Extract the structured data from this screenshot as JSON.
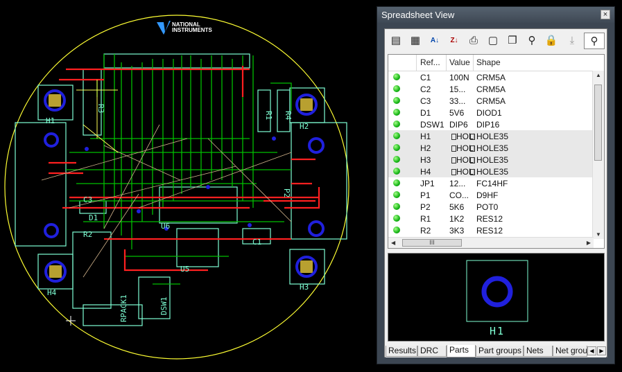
{
  "board": {
    "logo_line1": "NATIONAL",
    "logo_line2": "INSTRUMENTS",
    "labels": [
      "H1",
      "H2",
      "H3",
      "H4",
      "R3",
      "R1",
      "R4",
      "C3",
      "D1",
      "R2",
      "U5",
      "C1",
      "U6",
      "P2",
      "RPACK1",
      "DSW1"
    ],
    "colors": {
      "outline": "#ffff33",
      "silk": "#7fffd4",
      "top": "#ff2020",
      "bottom": "#00c000",
      "pad": "#0000cc",
      "ratsnest": "#d2b48c"
    }
  },
  "panel": {
    "title": "Spreadsheet View",
    "close": "×",
    "toolbar": [
      "page-icon",
      "spreadsheet-icon",
      "sort-az-icon",
      "sort-za-icon",
      "print-icon",
      "select-icon",
      "copy-icon",
      "find-icon",
      "lock-icon",
      "import-icon",
      "zoom-icon"
    ],
    "columns": [
      "Ref...",
      "Value",
      "Shape"
    ],
    "rows": [
      {
        "ref": "C1",
        "value": "100N",
        "shape": "CRM5A",
        "sel": false,
        "hole": false
      },
      {
        "ref": "C2",
        "value": "15...",
        "shape": "CRM5A",
        "sel": false,
        "hole": false
      },
      {
        "ref": "C3",
        "value": "33...",
        "shape": "CRM5A",
        "sel": false,
        "hole": false
      },
      {
        "ref": "D1",
        "value": "5V6",
        "shape": "DIOD1",
        "sel": false,
        "hole": false
      },
      {
        "ref": "DSW1",
        "value": "DIP6",
        "shape": "DIP16",
        "sel": false,
        "hole": false
      },
      {
        "ref": "H1",
        "value": "HOLE",
        "shape": "HOLE35",
        "sel": true,
        "hole": true
      },
      {
        "ref": "H2",
        "value": "HOLE",
        "shape": "HOLE35",
        "sel": true,
        "hole": true
      },
      {
        "ref": "H3",
        "value": "HOLE",
        "shape": "HOLE35",
        "sel": true,
        "hole": true
      },
      {
        "ref": "H4",
        "value": "HOLE",
        "shape": "HOLE35",
        "sel": true,
        "hole": true
      },
      {
        "ref": "JP1",
        "value": "12...",
        "shape": "FC14HF",
        "sel": false,
        "hole": false
      },
      {
        "ref": "P1",
        "value": "CO...",
        "shape": "D9HF",
        "sel": false,
        "hole": false
      },
      {
        "ref": "P2",
        "value": "5K6",
        "shape": "POT0",
        "sel": false,
        "hole": false
      },
      {
        "ref": "R1",
        "value": "1K2",
        "shape": "RES12",
        "sel": false,
        "hole": false
      },
      {
        "ref": "R2",
        "value": "3K3",
        "shape": "RES12",
        "sel": false,
        "hole": false
      }
    ],
    "hscroll_grip": "III",
    "preview_label": "H1",
    "tabs": [
      "Results",
      "DRC",
      "Parts",
      "Part groups",
      "Nets",
      "Net grou"
    ],
    "active_tab": "Parts"
  }
}
